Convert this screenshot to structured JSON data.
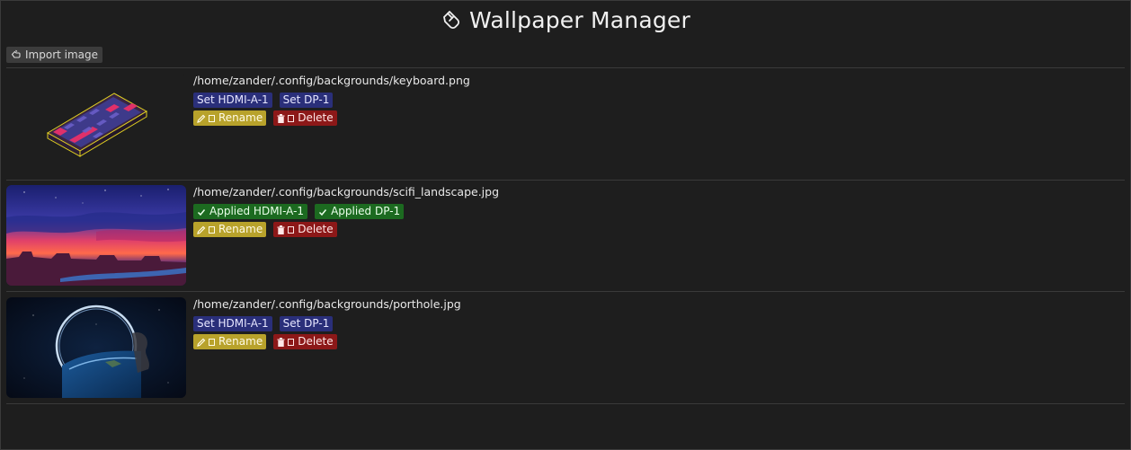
{
  "app": {
    "title": "Wallpaper Manager",
    "title_icon": "hand-icon"
  },
  "toolbar": {
    "import_label": "Import image",
    "import_icon": "hand-icon"
  },
  "colors": {
    "background": "#1e1e1e",
    "set_button": "#2a2f7a",
    "applied_button": "#1c6a20",
    "rename_button": "#b8a22b",
    "delete_button": "#8c1818"
  },
  "wallpapers": [
    {
      "path": "/home/zander/.config/backgrounds/keyboard.png",
      "monitors": [
        {
          "label": "Set HDMI-A-1",
          "state": "set"
        },
        {
          "label": "Set DP-1",
          "state": "set"
        }
      ],
      "rename_label": "Rename",
      "delete_label": "Delete"
    },
    {
      "path": "/home/zander/.config/backgrounds/scifi_landscape.jpg",
      "monitors": [
        {
          "label": "Applied HDMI-A-1",
          "state": "applied"
        },
        {
          "label": "Applied DP-1",
          "state": "applied"
        }
      ],
      "rename_label": "Rename",
      "delete_label": "Delete"
    },
    {
      "path": "/home/zander/.config/backgrounds/porthole.jpg",
      "monitors": [
        {
          "label": "Set HDMI-A-1",
          "state": "set"
        },
        {
          "label": "Set DP-1",
          "state": "set"
        }
      ],
      "rename_label": "Rename",
      "delete_label": "Delete"
    }
  ]
}
